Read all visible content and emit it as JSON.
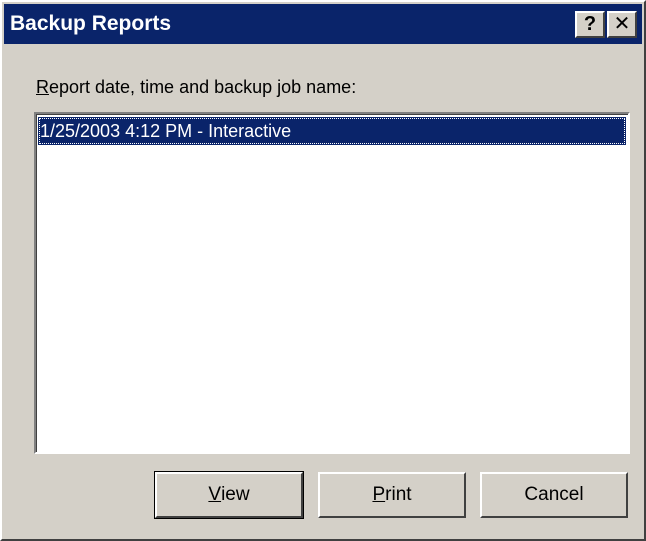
{
  "window": {
    "title": "Backup Reports",
    "help_glyph": "?",
    "close_glyph": "✕"
  },
  "label": {
    "accel": "R",
    "rest": "eport date, time and backup job name:"
  },
  "list": {
    "items": [
      {
        "text": "1/25/2003  4:12 PM - Interactive",
        "selected": true
      }
    ]
  },
  "buttons": {
    "view": {
      "accel": "V",
      "rest": "iew"
    },
    "print": {
      "accel": "P",
      "rest": "rint"
    },
    "cancel": {
      "label": "Cancel"
    }
  },
  "colors": {
    "titlebar": "#0a246a",
    "face": "#d4d0c8",
    "selection": "#0a246a"
  }
}
